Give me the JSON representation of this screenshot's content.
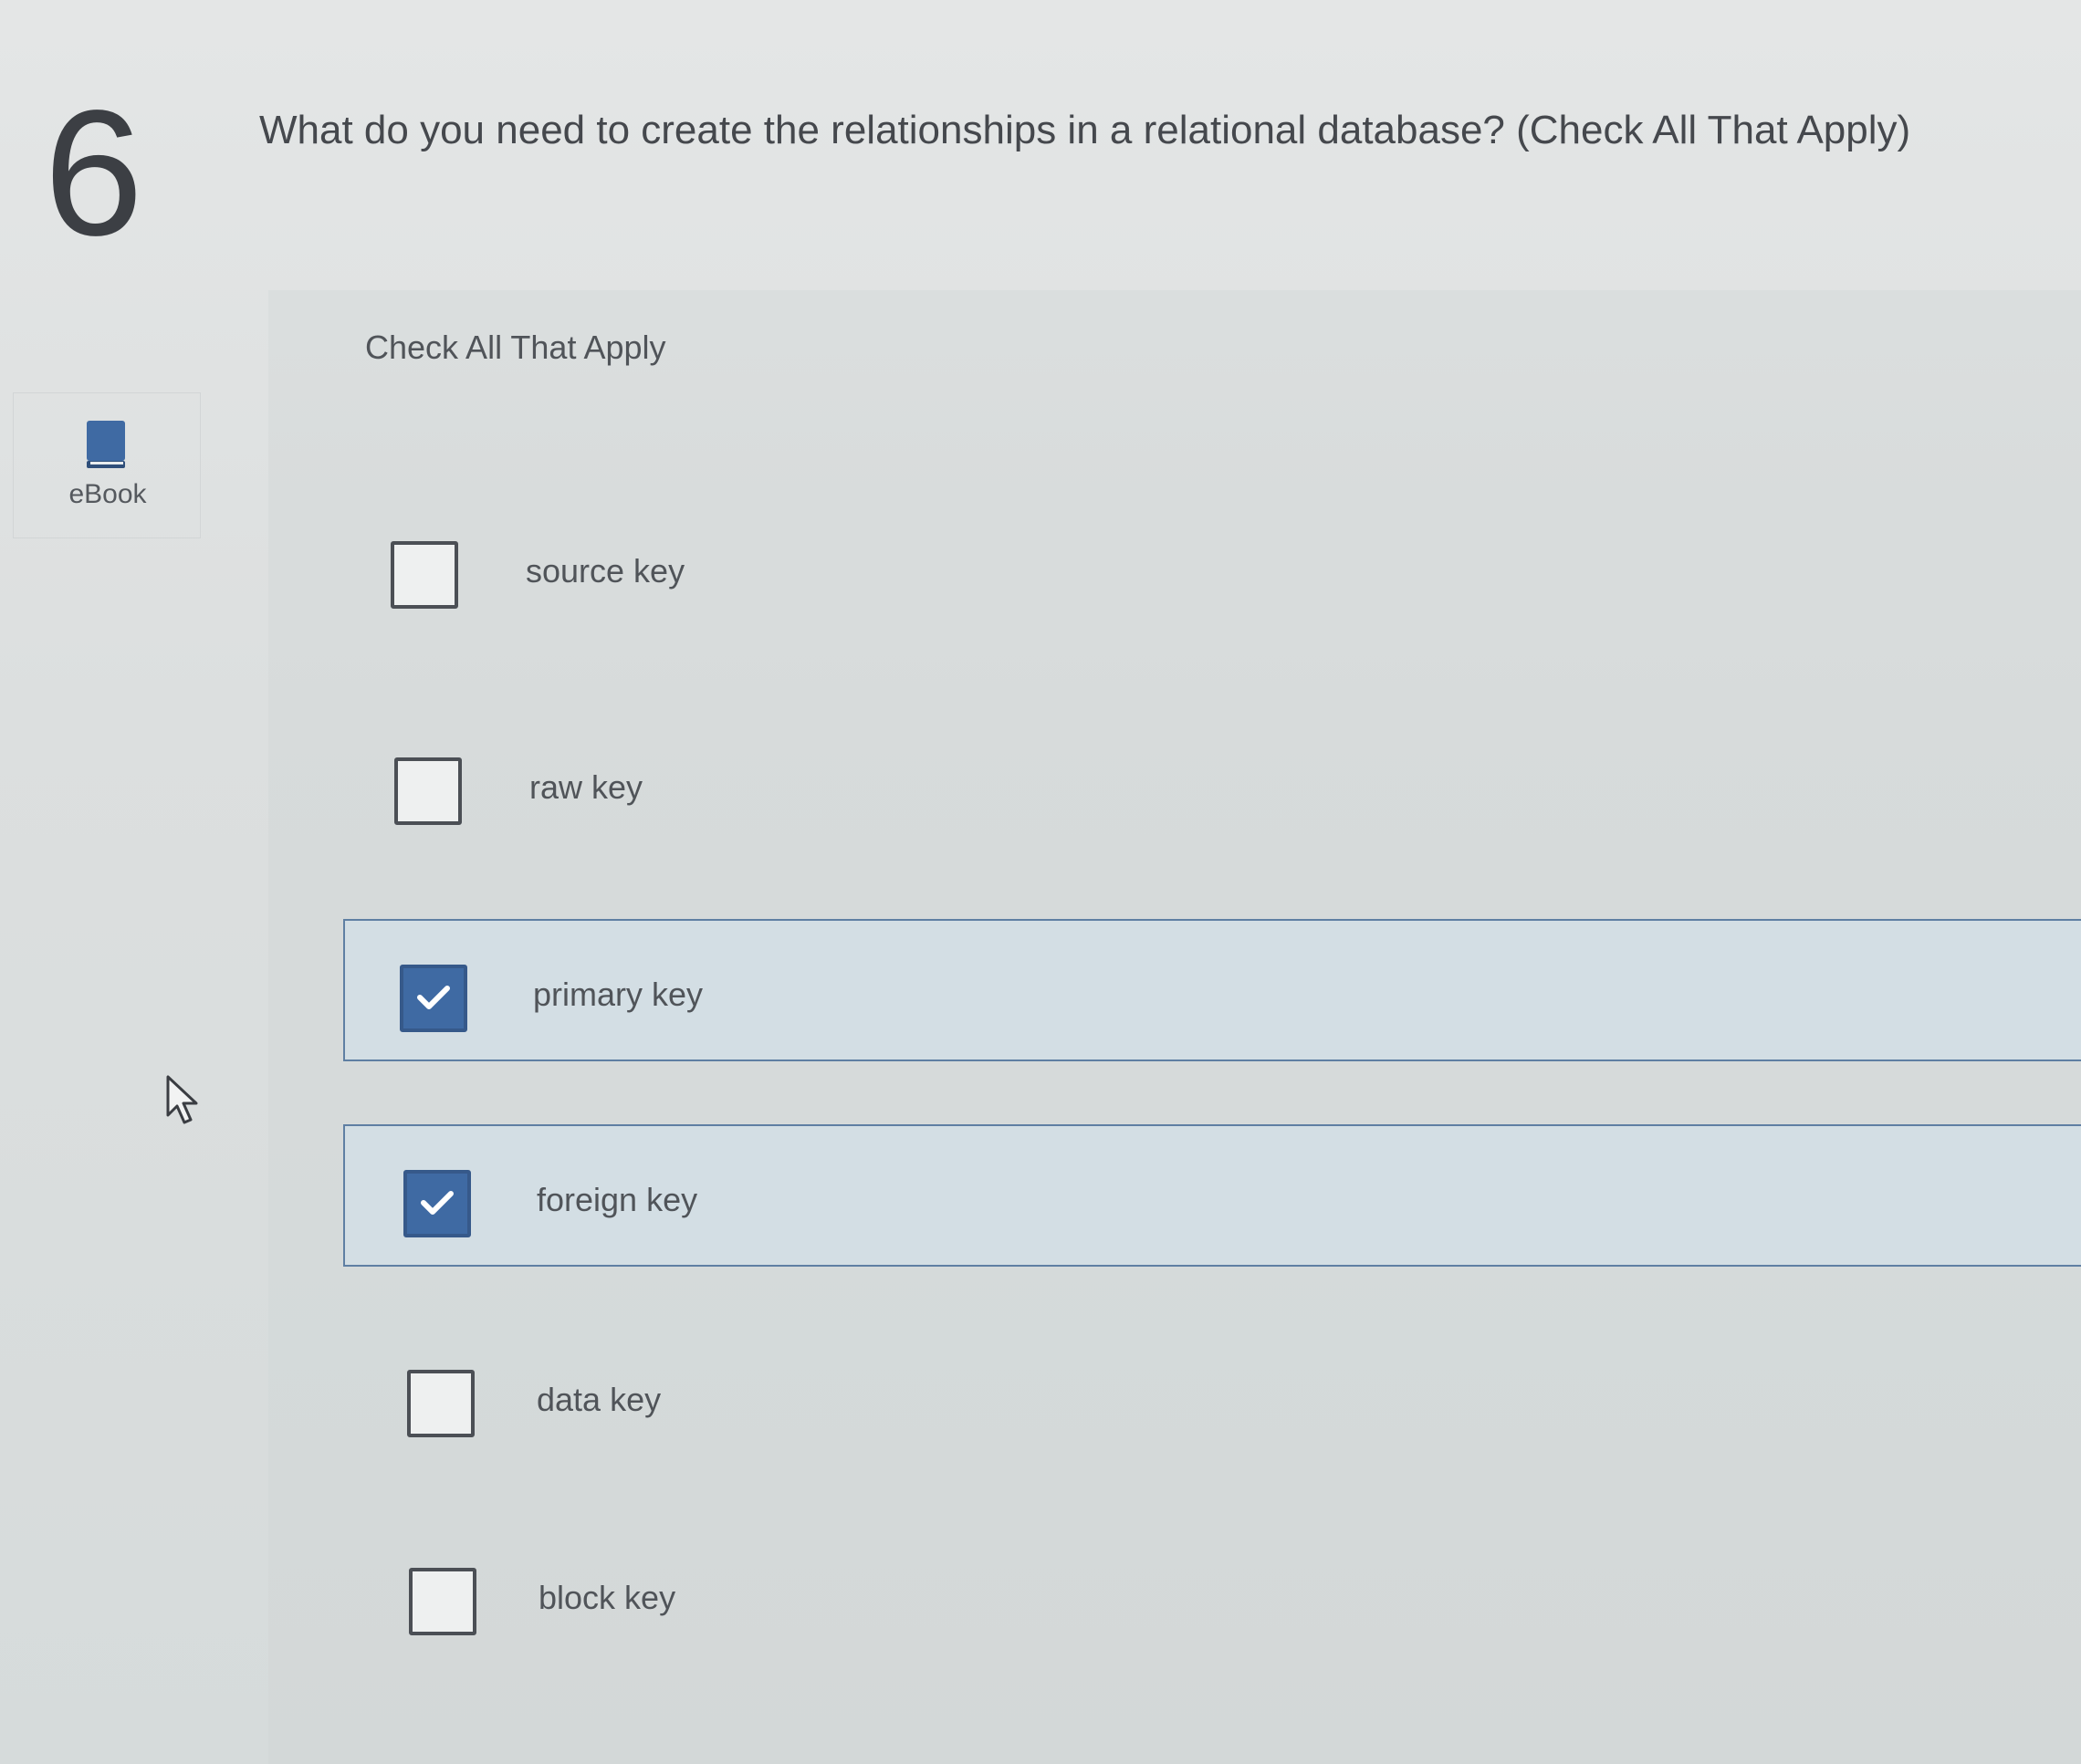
{
  "question": {
    "number": "6",
    "text": "What do you need to create the relationships in a relational database? (Check All That Apply)"
  },
  "sidebar": {
    "ebook": {
      "icon": "book-icon",
      "label": "eBook"
    }
  },
  "answers": {
    "instruction": "Check All That Apply",
    "options": [
      {
        "label": "source key",
        "checked": false
      },
      {
        "label": "raw key",
        "checked": false
      },
      {
        "label": "primary key",
        "checked": true
      },
      {
        "label": "foreign key",
        "checked": true
      },
      {
        "label": "data key",
        "checked": false
      },
      {
        "label": "block key",
        "checked": false
      }
    ]
  },
  "colors": {
    "checked_fill": "#3f6aa3",
    "selected_row": "#d3dee4",
    "selected_border": "#5f7fa3"
  }
}
